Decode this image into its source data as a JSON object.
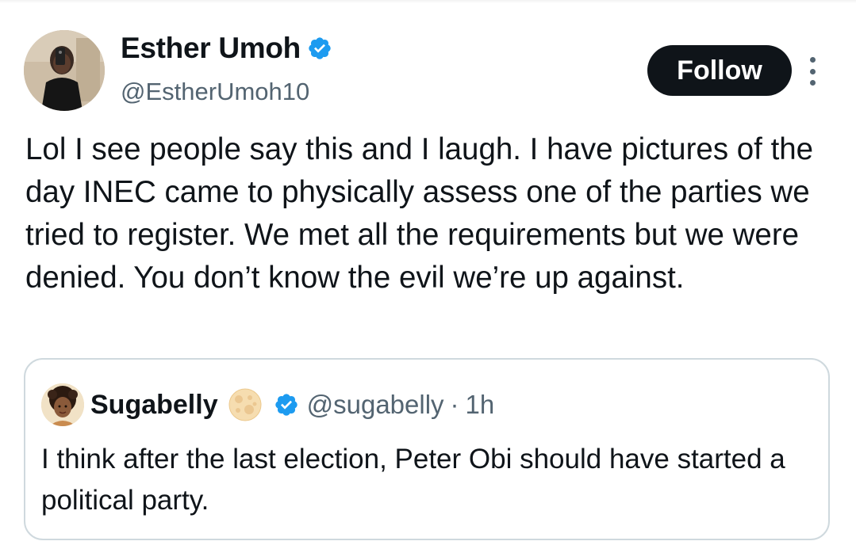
{
  "tweet": {
    "author_name": "Esther Umoh",
    "author_handle": "@EstherUmoh10",
    "follow_label": "Follow",
    "text": "Lol I see people say this and I laugh. I have pictures of the day INEC came to physically assess one of the parties we tried to register. We met all the requirements but we were denied. You don’t know the evil we’re up against."
  },
  "quoted_tweet": {
    "author_name": "Sugabelly",
    "author_handle": "@sugabelly",
    "separator": "·",
    "time": "1h",
    "text": "I think after the last election, Peter Obi should have started a political party."
  },
  "icons": {
    "verified": "verified-badge-icon",
    "more": "more-options-icon",
    "emoji": "moon-emoji-icon"
  },
  "colors": {
    "verified_blue": "#1d9bf0",
    "follow_bg": "#0f1419",
    "secondary_text": "#536471",
    "border": "#cfd9de"
  }
}
